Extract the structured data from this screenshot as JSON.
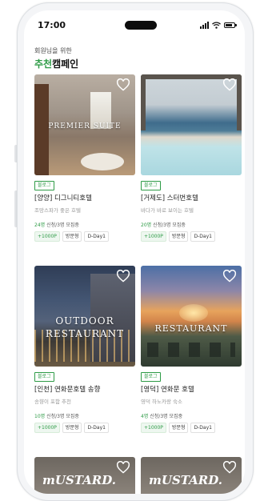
{
  "status_bar": {
    "time": "17:00"
  },
  "header": {
    "subtitle": "회원님을 위한",
    "title_accent": "추천",
    "title_rest": "캠페인"
  },
  "colors": {
    "accent": "#2e9b46"
  },
  "cards": [
    {
      "image_text": "PREMIER SUITE",
      "tag": "블로그",
      "title": "[양양] 디그니티호텔",
      "desc": "조망스파가 좋은 호텔",
      "recruit_count": "24명",
      "recruit_rest": " 신청/3명 모집중",
      "chips": [
        "+1000P",
        "방문형",
        "D-Day1"
      ]
    },
    {
      "image_text": "",
      "tag": "블로그",
      "title": "[거제도] 스터번호텔",
      "desc": "바다가 바로 보이는 호텔",
      "recruit_count": "20명",
      "recruit_rest": " 신청/3명 모집중",
      "chips": [
        "+1000P",
        "방문형",
        "D-Day1"
      ]
    },
    {
      "image_text_1": "OUTDOOR",
      "image_text_2": "RESTAURANT",
      "tag": "블로그",
      "title": "[인천] 연화문호텔 송향",
      "desc": "송향이 포함 추천",
      "recruit_count": "10명",
      "recruit_rest": " 신청/3명 모집중",
      "chips": [
        "+1000P",
        "방문형",
        "D-Day1"
      ]
    },
    {
      "image_text": "RESTAURANT",
      "tag": "블로그",
      "title": "[영덕] 연화문 호텔",
      "desc": "영덕 하노카랑 숙소",
      "recruit_count": "4명",
      "recruit_rest": " 신청/3명 모집중",
      "chips": [
        "+1000P",
        "방문형",
        "D-Day1"
      ]
    }
  ],
  "bottom_cards": [
    {
      "brand": "mUSTARD."
    },
    {
      "brand": "mUSTARD."
    }
  ],
  "icons": [
    "heart-icon",
    "signal-icon",
    "wifi-icon",
    "battery-icon"
  ]
}
